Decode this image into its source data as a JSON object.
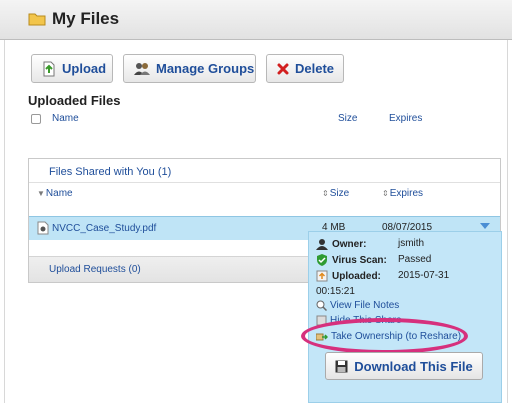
{
  "header": {
    "title": "My Files"
  },
  "toolbar": {
    "upload_label": "Upload",
    "manage_groups_label": "Manage Groups",
    "delete_label": "Delete"
  },
  "uploaded": {
    "title": "Uploaded Files",
    "columns": {
      "name": "Name",
      "size": "Size",
      "expires": "Expires"
    }
  },
  "shared": {
    "title": "Files Shared with You (1)",
    "columns": {
      "name": "Name",
      "size": "Size",
      "expires": "Expires"
    },
    "rows": [
      {
        "name": "NVCC_Case_Study.pdf",
        "size": "4 MB",
        "expires": "08/07/2015"
      }
    ]
  },
  "details": {
    "owner_label": "Owner:",
    "owner_value": "jsmith",
    "virus_label": "Virus Scan:",
    "virus_value": "Passed",
    "uploaded_label": "Uploaded:",
    "uploaded_value": "2015-07-31",
    "uploaded_time": "00:15:21",
    "view_notes": "View File Notes",
    "hide_share": "Hide This Share",
    "take_ownership": "Take Ownership (to Reshare)",
    "download_label": "Download This File"
  },
  "requests": {
    "label": "Upload Requests (0)"
  },
  "colors": {
    "link": "#1f4e9a",
    "highlight": "#bfe4f6",
    "annotation": "#d6307d"
  }
}
